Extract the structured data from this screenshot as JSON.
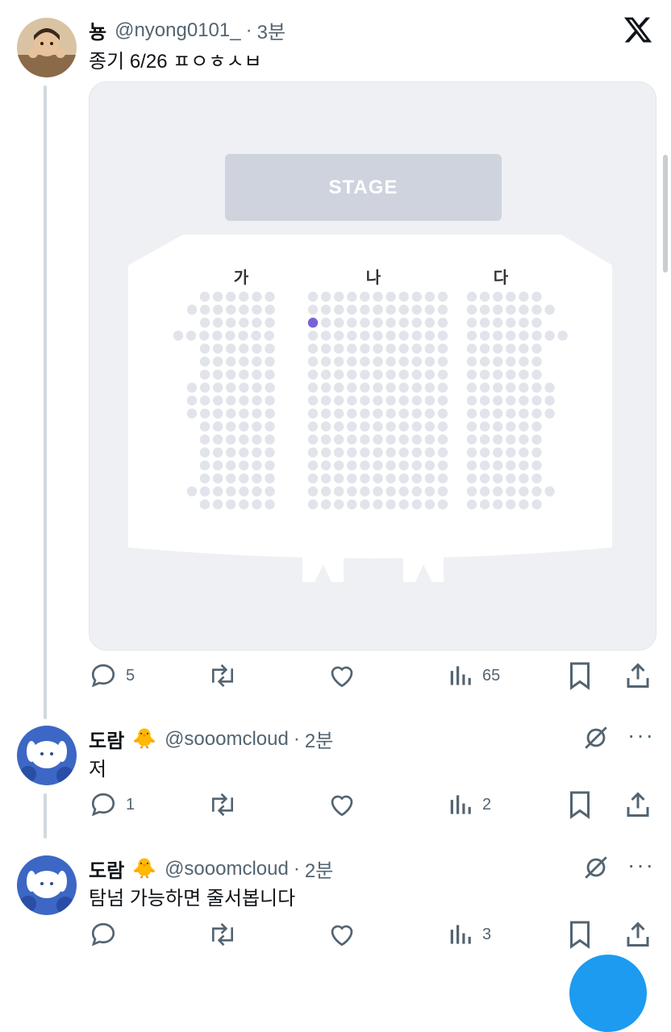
{
  "tweet": {
    "name": "뇽",
    "handle": "@nyong0101_",
    "time": "3분",
    "text": "종기 6/26 ㅍㅇㅎㅅㅂ",
    "media": {
      "stage_label": "STAGE",
      "sections": [
        "가",
        "나",
        "다"
      ],
      "selected_seat_color": "#7b61d9"
    },
    "actions": {
      "replies": "5",
      "views": "65"
    }
  },
  "replies": [
    {
      "name": "도람",
      "emoji": "🐥",
      "handle": "@sooomcloud",
      "time": "2분",
      "text": "저",
      "actions": {
        "replies": "1",
        "views": "2"
      }
    },
    {
      "name": "도람",
      "emoji": "🐥",
      "handle": "@sooomcloud",
      "time": "2분",
      "text": "탐넘 가능하면 줄서봅니다",
      "actions": {
        "replies": "",
        "views": "3"
      }
    }
  ],
  "menu_glyph": "···",
  "colors": {
    "accent": "#1d9bf0",
    "muted": "#536471",
    "seat": "#e1e4ea"
  }
}
